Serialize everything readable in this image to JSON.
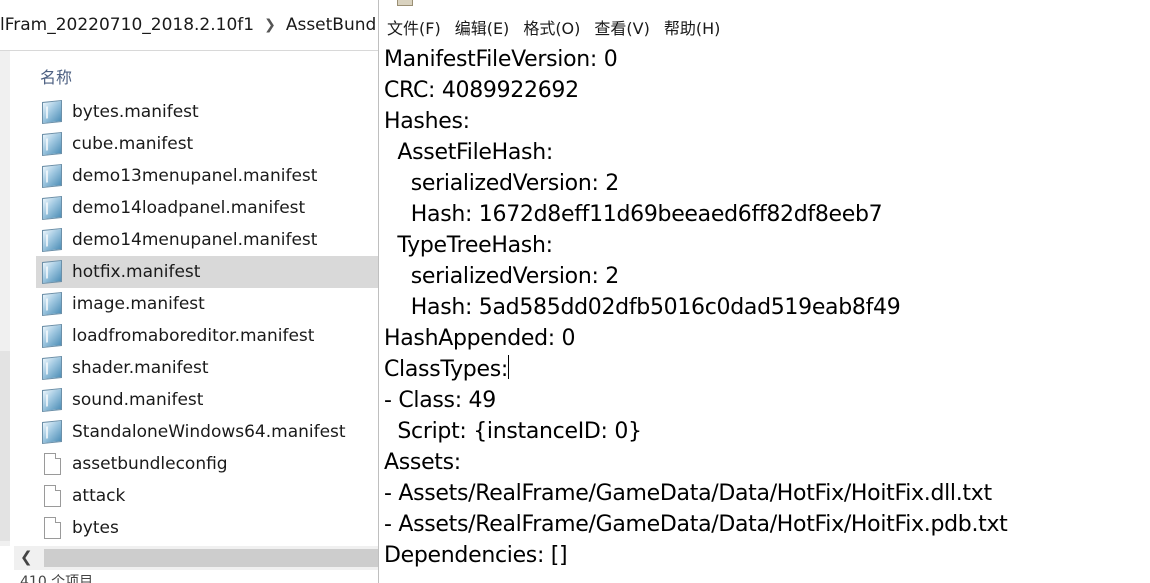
{
  "explorer": {
    "breadcrumb": {
      "folder": "lFram_20220710_2018.2.10f1",
      "subfolder": "AssetBund"
    },
    "column_header": "名称",
    "files": [
      {
        "name": "bytes.manifest",
        "icon": "manifest-file-icon",
        "selected": false
      },
      {
        "name": "cube.manifest",
        "icon": "manifest-file-icon",
        "selected": false
      },
      {
        "name": "demo13menupanel.manifest",
        "icon": "manifest-file-icon",
        "selected": false
      },
      {
        "name": "demo14loadpanel.manifest",
        "icon": "manifest-file-icon",
        "selected": false
      },
      {
        "name": "demo14menupanel.manifest",
        "icon": "manifest-file-icon",
        "selected": false
      },
      {
        "name": "hotfix.manifest",
        "icon": "manifest-file-icon",
        "selected": true
      },
      {
        "name": "image.manifest",
        "icon": "manifest-file-icon",
        "selected": false
      },
      {
        "name": "loadfromaboreditor.manifest",
        "icon": "manifest-file-icon",
        "selected": false
      },
      {
        "name": "shader.manifest",
        "icon": "manifest-file-icon",
        "selected": false
      },
      {
        "name": "sound.manifest",
        "icon": "manifest-file-icon",
        "selected": false
      },
      {
        "name": "StandaloneWindows64.manifest",
        "icon": "manifest-file-icon",
        "selected": false
      },
      {
        "name": "assetbundleconfig",
        "icon": "blank-file-icon",
        "selected": false
      },
      {
        "name": "attack",
        "icon": "blank-file-icon",
        "selected": false
      },
      {
        "name": "bytes",
        "icon": "blank-file-icon",
        "selected": false
      }
    ],
    "status_text": "410 个项目"
  },
  "notepad": {
    "menu": [
      "文件(F)",
      "编辑(E)",
      "格式(O)",
      "查看(V)",
      "帮助(H)"
    ],
    "lines": [
      "ManifestFileVersion: 0",
      "CRC: 4089922692",
      "Hashes:",
      "  AssetFileHash:",
      "    serializedVersion: 2",
      "    Hash: 1672d8eff11d69beeaed6ff82df8eeb7",
      "  TypeTreeHash:",
      "    serializedVersion: 2",
      "    Hash: 5ad585dd02dfb5016c0dad519eab8f49",
      "HashAppended: 0",
      "ClassTypes:",
      "- Class: 49",
      "  Script: {instanceID: 0}",
      "Assets:",
      "- Assets/RealFrame/GameData/Data/HotFix/HoitFix.dll.txt",
      "- Assets/RealFrame/GameData/Data/HotFix/HoitFix.pdb.txt",
      "Dependencies: []"
    ],
    "caret_line": 10
  },
  "colors": {
    "selection": "#d9d9d9",
    "header_text": "#4d6082"
  }
}
